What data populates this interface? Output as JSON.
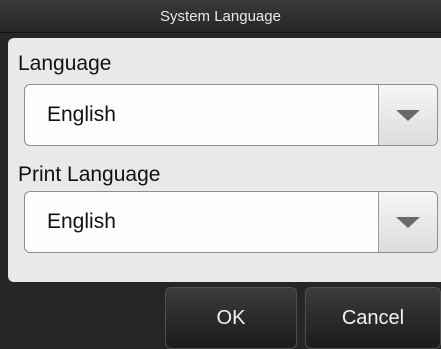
{
  "dialog": {
    "title": "System Language",
    "language": {
      "label": "Language",
      "value": "English"
    },
    "print_language": {
      "label": "Print Language",
      "value": "English"
    },
    "buttons": {
      "ok": "OK",
      "cancel": "Cancel"
    }
  },
  "icons": {
    "dropdown": "chevron-down-icon"
  }
}
